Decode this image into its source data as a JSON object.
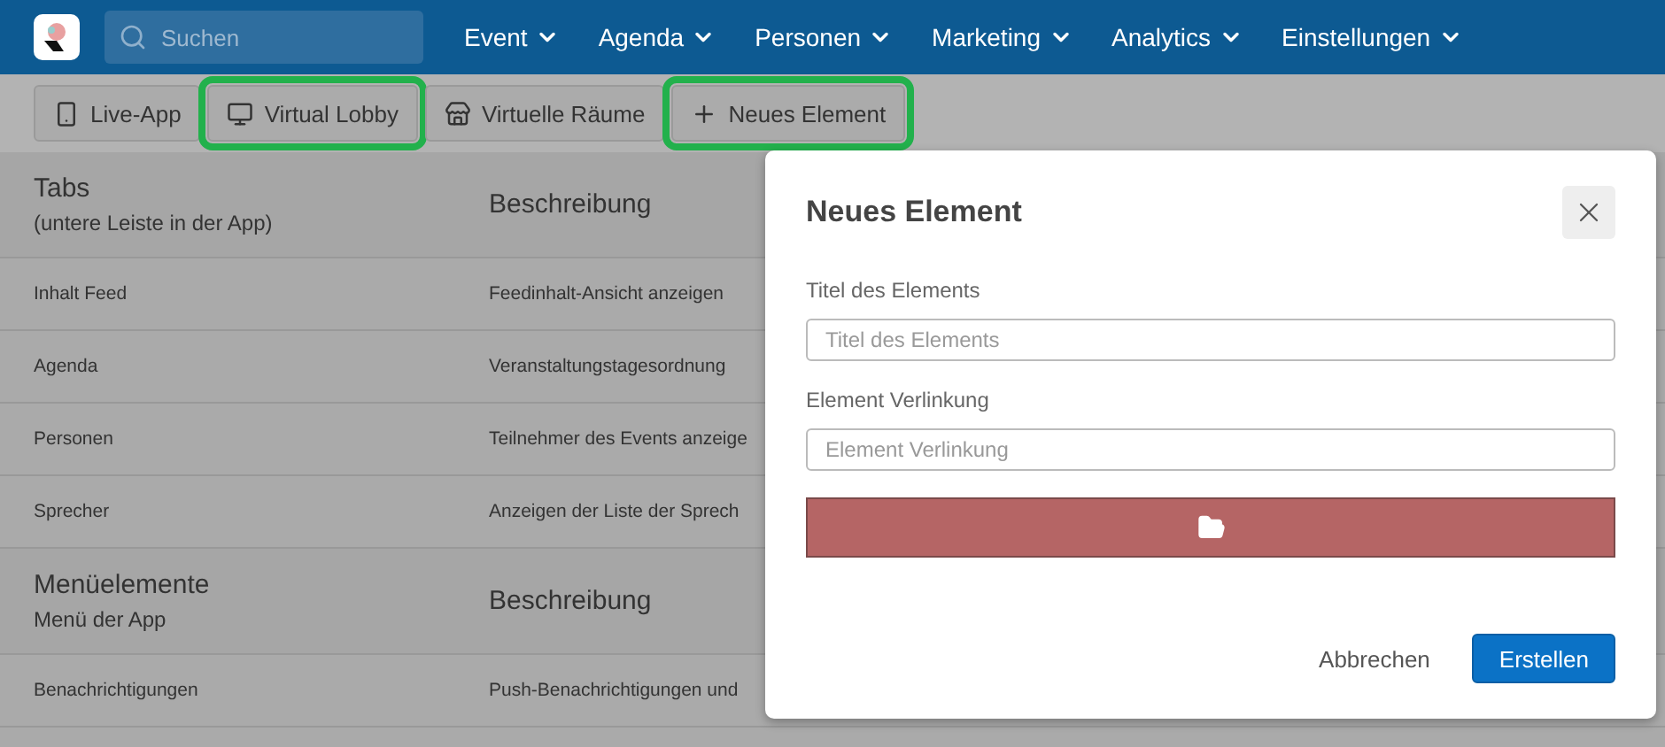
{
  "nav": {
    "search": {
      "placeholder": "Suchen"
    },
    "menus": [
      "Event",
      "Agenda",
      "Personen",
      "Marketing",
      "Analytics",
      "Einstellungen"
    ]
  },
  "toolbar": [
    {
      "label": "Live-App",
      "kind": "phone",
      "highlighted": false
    },
    {
      "label": "Virtual Lobby",
      "kind": "monitor",
      "highlighted": true
    },
    {
      "label": "Virtuelle Räume",
      "kind": "store",
      "highlighted": false
    },
    {
      "label": "Neues Element",
      "kind": "plus",
      "highlighted": true
    }
  ],
  "sections": [
    {
      "title": "Tabs",
      "subtitle": "(untere Leiste in der App)",
      "description_header": "Beschreibung",
      "rows": [
        {
          "name": "Inhalt Feed",
          "description": "Feedinhalt-Ansicht anzeigen"
        },
        {
          "name": "Agenda",
          "description": "Veranstaltungstagesordnung"
        },
        {
          "name": "Personen",
          "description": "Teilnehmer des Events anzeige"
        },
        {
          "name": "Sprecher",
          "description": "Anzeigen der Liste der Sprech"
        }
      ]
    },
    {
      "title": "Menüelemente",
      "subtitle": "Menü der App",
      "description_header": "Beschreibung",
      "rows": [
        {
          "name": "Benachrichtigungen",
          "description": "Push-Benachrichtigungen und"
        }
      ]
    }
  ],
  "dialog": {
    "title": "Neues Element",
    "fields": [
      {
        "label": "Titel des Elements",
        "placeholder": "Titel des Elements"
      },
      {
        "label": "Element Verlinkung",
        "placeholder": "Element Verlinkung"
      }
    ],
    "buttons": {
      "cancel": "Abbrechen",
      "submit": "Erstellen"
    }
  }
}
